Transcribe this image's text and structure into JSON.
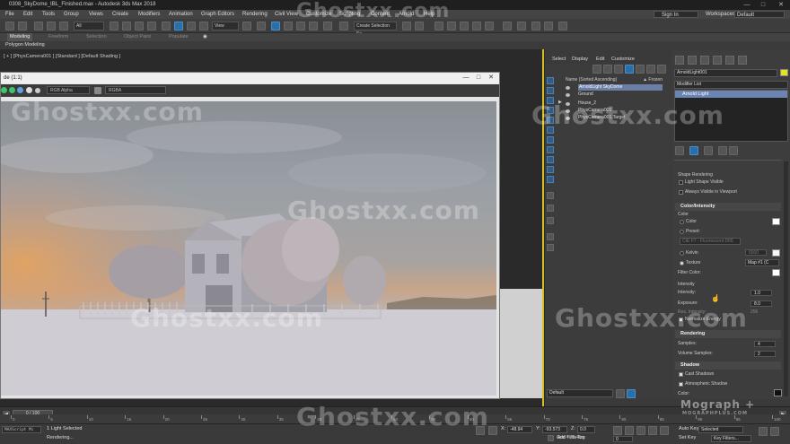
{
  "window": {
    "title": "0308_SkyDome_IBL_Finished.max - Autodesk 3ds Max 2018",
    "minimize": "—",
    "maximize": "□",
    "close": "✕"
  },
  "menu": {
    "items": [
      "File",
      "Edit",
      "Tools",
      "Group",
      "Views",
      "Create",
      "Modifiers",
      "Animation",
      "Graph Editors",
      "Rendering",
      "Civil View",
      "Customize",
      "Scripting",
      "Content",
      "Arnold",
      "Help"
    ],
    "sign_in": "Sign In",
    "workspaces_label": "Workspaces:",
    "workspace_value": "Default"
  },
  "toolbar": {
    "selection_filter": "All",
    "view_dropdown": "View",
    "create_selection_set": "Create Selection Se"
  },
  "ribbon": {
    "tabs": [
      "Modeling",
      "Freeform",
      "Selection",
      "Object Paint",
      "Populate"
    ],
    "sub_label": "Polygon Modeling"
  },
  "viewport": {
    "label": "[ + ] [PhysCamera001 ] [Standard ] [Default Shading ]"
  },
  "frame_window": {
    "title": "de (1:1)",
    "channel_dropdown": "RGB Alpha",
    "display_dropdown": "RGBA"
  },
  "scene_explorer": {
    "tabs": [
      "Select",
      "Display",
      "Edit",
      "Customize"
    ],
    "header_name": "Name (Sorted Ascending)",
    "header_frozen": "▲ Frozen",
    "rows": [
      {
        "name": "ArnoldLight SkyDome",
        "selected": true
      },
      {
        "name": "Ground",
        "selected": false
      },
      {
        "name": "House_2",
        "selected": false
      },
      {
        "name": "PhysCamera001",
        "selected": false
      },
      {
        "name": "PhysCamera001.Target",
        "selected": false
      }
    ],
    "layer_dropdown": "Default"
  },
  "command_panel": {
    "object_name": "ArnoldLight001",
    "modifier_list": "Modifier List",
    "modifier_stack_item": "Arnold Light",
    "shape_rendering_label": "Shape Rendering",
    "light_shape_visible": "Light Shape Visible",
    "always_visible": "Always Visible in Viewport",
    "color_intensity_header": "Color/Intensity",
    "color_group": "Color",
    "color_option": "Color",
    "preset_option": "Preset:",
    "preset_value": "CIE F7 - Fluorescent D65",
    "kelvin_option": "Kelvin",
    "kelvin_value": "6500",
    "texture_option": "Texture",
    "texture_map": "Map #1 (C",
    "filter_color": "Filter Color:",
    "intensity_group": "Intensity",
    "intensity_label": "Intensity:",
    "intensity_value": "1.0",
    "exposure_label": "Exposure:",
    "exposure_value": "8.0",
    "res_intensity_label": "Res. Intensity:",
    "res_intensity_value": "256",
    "normalize_energy": "Normalize Energy",
    "rendering_header": "Rendering",
    "samples_label": "Samples:",
    "samples_value": "4",
    "volume_samples_label": "Volume Samples:",
    "volume_samples_value": "2",
    "shadow_header": "Shadow",
    "cast_shadows": "Cast Shadows",
    "atmospheric_shadow": "Atmospheric Shadow",
    "shadow_color_label": "Color:"
  },
  "timeline": {
    "frame_counter": "0 / 100",
    "ticks": [
      "0",
      "5",
      "10",
      "15",
      "20",
      "25",
      "30",
      "35",
      "40",
      "45",
      "50",
      "55",
      "60",
      "65",
      "70",
      "75",
      "80",
      "85",
      "90",
      "95",
      "100"
    ]
  },
  "status": {
    "maxscript": "MAXScript Mi",
    "selected": "1 Light Selected",
    "rendering": "Rendering...",
    "x_label": "X:",
    "x_value": "-48.94",
    "y_label": "Y:",
    "y_value": "-93.573",
    "z_label": "Z:",
    "z_value": "0.0",
    "grid": "Grid = 25.4cm",
    "add_time_tag": "Add Time Tag",
    "auto_key": "Auto Key",
    "selected_mode": "Selected",
    "set_key": "Set Key",
    "key_filters": "Key Filters...",
    "frame_value": "0"
  },
  "watermark": {
    "text": "Ghostxx.com",
    "brand": "Mograph +",
    "brand_sub": "MOGRAPHPLUS.COM"
  },
  "colors": {
    "accent_blue": "#2b6ea8",
    "selection_blue": "#6c84b4",
    "viewport_border": "#d8c020"
  }
}
